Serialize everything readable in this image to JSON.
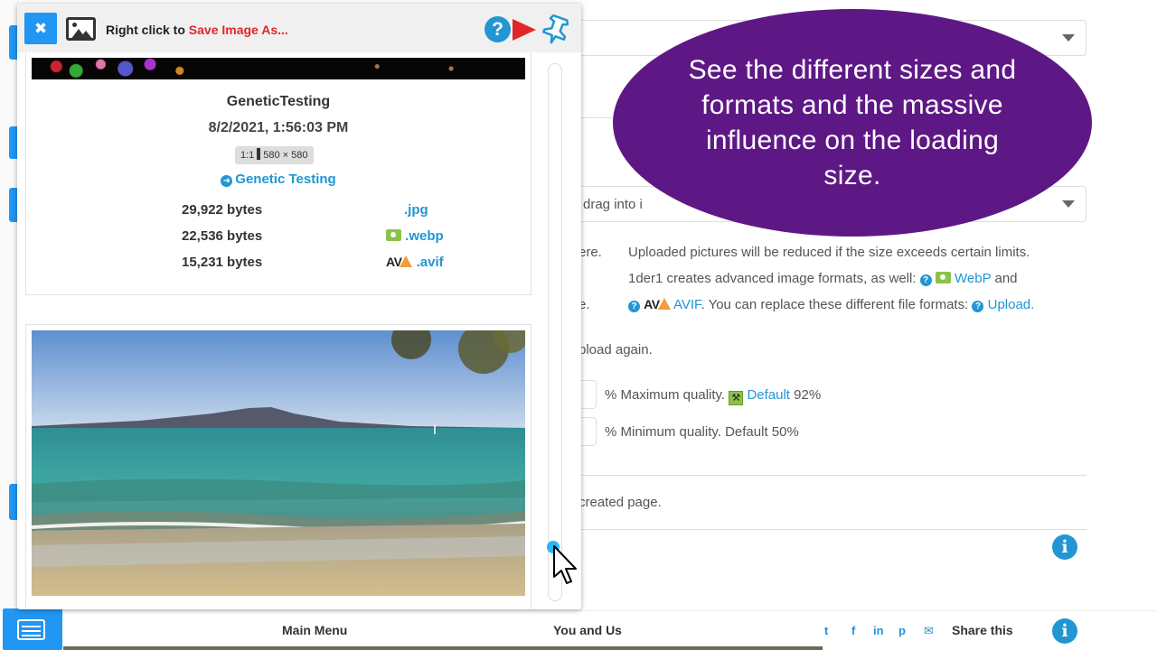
{
  "popup": {
    "close_label": "✖",
    "header_prefix": "Right click to ",
    "header_action": "Save Image As...",
    "help_label": "?",
    "image": {
      "title": "GeneticTesting",
      "date": "8/2/2021, 1:56:03 PM",
      "ratio_label": "1:1",
      "dimensions": "580 × 580",
      "link_label": "Genetic Testing"
    },
    "sizes": [
      {
        "bytes": "29,922 bytes",
        "format": ".jpg"
      },
      {
        "bytes": "22,536 bytes",
        "format": ".webp"
      },
      {
        "bytes": "15,231 bytes",
        "format": ".avif"
      }
    ],
    "av_logo": "AV"
  },
  "callout": {
    "text": "See the different sizes and formats and the massive influence on the loading size."
  },
  "background": {
    "drag_text": "drag into i",
    "frag_here": "ere.",
    "frag_e": "e.",
    "info_line1": "Uploaded pictures will be reduced if the size exceeds certain limits.",
    "info_line2_prefix": "1der1 creates advanced image formats, as well:",
    "webp_label": "WebP",
    "and_label": "and",
    "av_logo": "AV",
    "avif_label": "AVIF",
    "info_line3_mid": ". You can replace these different file formats:",
    "upload_label": "Upload.",
    "upload_again": "pload again.",
    "max_quality_prefix": "% Maximum quality.",
    "max_default_label": "Default",
    "max_default_value": "92%",
    "min_quality": "% Minimum quality. Default 50%",
    "created_page": "created page."
  },
  "bottom_bar": {
    "main_menu": "Main Menu",
    "you_and_us": "You and Us",
    "share_this": "Share this",
    "social": [
      "t",
      "f",
      "in",
      "p",
      "✉"
    ]
  },
  "colors": {
    "accent": "#2196f3",
    "link": "#2196d3",
    "callout_bg": "#5e1885",
    "red": "#e0262b"
  },
  "icons": [
    "close-icon",
    "image-icon",
    "help-icon",
    "play-icon",
    "pin-icon",
    "info-icon",
    "menu-icon",
    "twitter-icon",
    "facebook-icon",
    "linkedin-icon",
    "pinterest-icon",
    "mail-icon"
  ]
}
